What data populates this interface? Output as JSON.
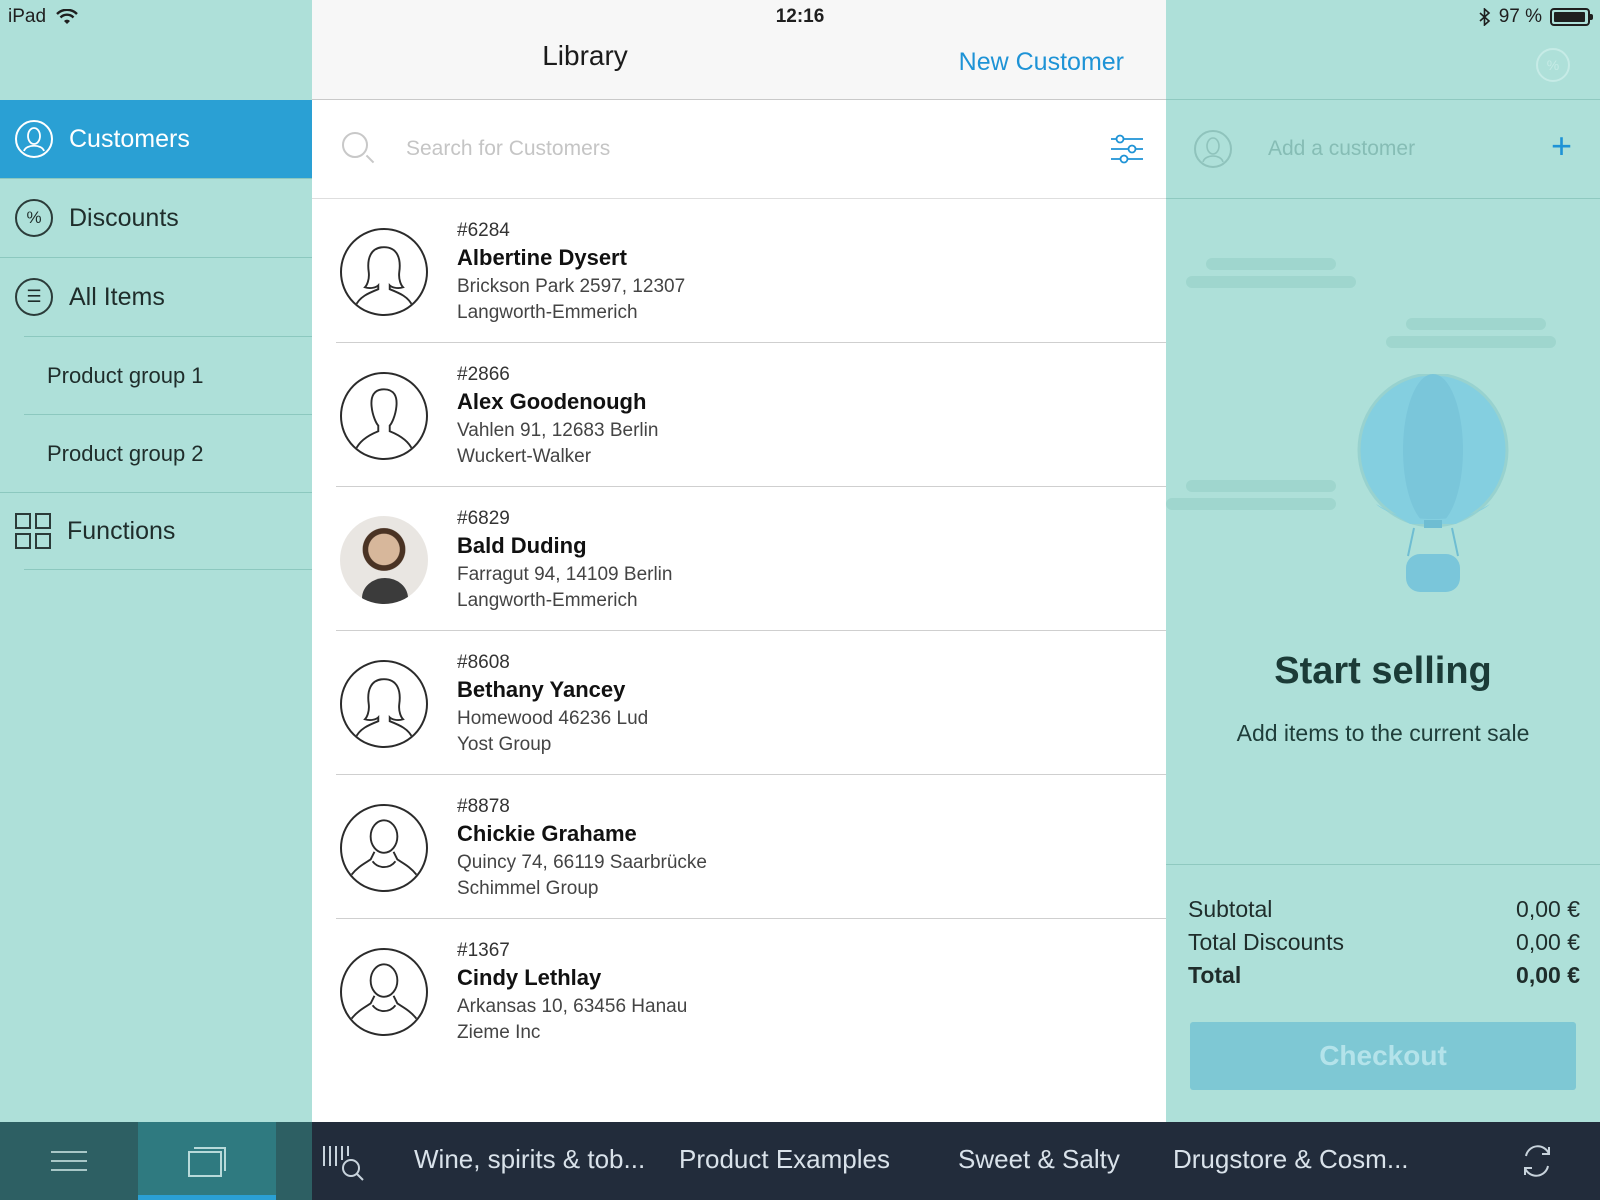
{
  "status_bar": {
    "device": "iPad",
    "time": "12:16",
    "battery": "97 %",
    "battery_level": 0.97
  },
  "sidebar": {
    "items": [
      {
        "label": "Customers",
        "icon": "person-icon",
        "active": true
      },
      {
        "label": "Discounts",
        "icon": "percent-icon"
      },
      {
        "label": "All Items",
        "icon": "list-icon"
      }
    ],
    "subitems": [
      {
        "label": "Product group 1"
      },
      {
        "label": "Product group 2"
      }
    ],
    "functions_label": "Functions"
  },
  "library": {
    "title": "Library",
    "new_customer_label": "New Customer",
    "search_placeholder": "Search for Customers",
    "customers": [
      {
        "number": "#6284",
        "name": "Albertine Dysert",
        "address": "Brickson Park 2597, 12307",
        "company": "Langworth-Emmerich",
        "avatar": "female-silhouette"
      },
      {
        "number": "#2866",
        "name": "Alex Goodenough",
        "address": "Vahlen 91, 12683 Berlin",
        "company": "Wuckert-Walker",
        "avatar": "male-silhouette"
      },
      {
        "number": "#6829",
        "name": "Bald Duding",
        "address": "Farragut 94, 14109 Berlin",
        "company": "Langworth-Emmerich",
        "avatar": "photo"
      },
      {
        "number": "#8608",
        "name": "Bethany Yancey",
        "address": "Homewood 46236 Lud",
        "company": "Yost Group",
        "avatar": "female-silhouette"
      },
      {
        "number": "#8878",
        "name": "Chickie Grahame",
        "address": "Quincy 74, 66119 Saarbrücke",
        "company": "Schimmel Group",
        "avatar": "bust-silhouette"
      },
      {
        "number": "#1367",
        "name": "Cindy Lethlay",
        "address": "Arkansas 10, 63456 Hanau",
        "company": "Zieme Inc",
        "avatar": "bust-silhouette"
      }
    ]
  },
  "sale": {
    "add_customer_label": "Add a customer",
    "empty_title": "Start selling",
    "empty_subtitle": "Add items to the current sale",
    "subtotal_label": "Subtotal",
    "subtotal_value": "0,00 €",
    "discounts_label": "Total Discounts",
    "discounts_value": "0,00 €",
    "total_label": "Total",
    "total_value": "0,00 €",
    "checkout_label": "Checkout"
  },
  "bottom_bar": {
    "categories": [
      "Wine, spirits & tob...",
      "Product Examples",
      "Sweet & Salty",
      "Drugstore & Cosm..."
    ]
  },
  "colors": {
    "accent": "#2aa0d4",
    "link": "#1e93d6",
    "sidebar_bg": "#aee0d9",
    "bottom_bar": "#222c3b"
  }
}
